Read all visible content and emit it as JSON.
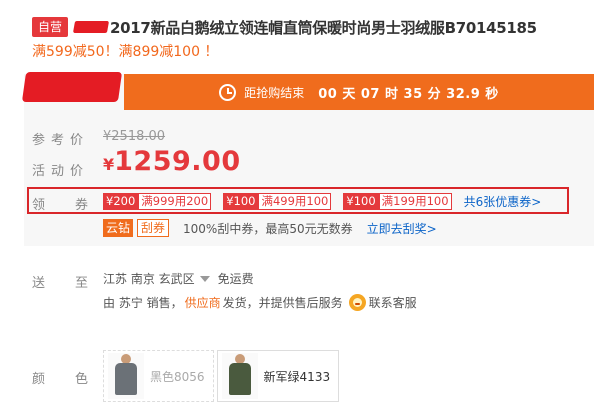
{
  "header": {
    "self_badge": "自营",
    "title": "2017新品白鹅绒立领连帽直筒保暖时尚男士羽绒服B70145185",
    "promo": "满599减50！满899减100 ！"
  },
  "flash_sale": {
    "label": "距抢购结束",
    "countdown": "00 天 07 时 35 分 32.9 秒"
  },
  "pricing": {
    "ref_label": "参考价",
    "ref_price": "¥2518.00",
    "sale_label": "活动价",
    "currency": "¥",
    "sale_price": "1259.00"
  },
  "coupons": {
    "label": "领券",
    "items": [
      {
        "amount": "¥200",
        "condition": "满999用200"
      },
      {
        "amount": "¥100",
        "condition": "满499用100"
      },
      {
        "amount": "¥100",
        "condition": "满199用100"
      }
    ],
    "more": "共6张优惠券>"
  },
  "services": {
    "tag1": "云钻",
    "tag2": "刮券",
    "text": "100%刮中券，最高50元无数券",
    "link": "立即去刮奖>"
  },
  "shipping": {
    "label": "送至",
    "location": "江苏 南京 玄武区",
    "fee": "免运费",
    "seller_prefix": "由 苏宁 销售，",
    "supplier": "供应商",
    "seller_suffix": "发货，并提供售后服务",
    "customer_service": "联系客服"
  },
  "colors": {
    "label": "颜色",
    "options": [
      {
        "name": "黑色8056",
        "available": false
      },
      {
        "name": "新军绿4133",
        "available": true
      }
    ]
  },
  "theme": {
    "accent": "#e4393c",
    "orange": "#f06c1d",
    "link": "#0c64c8"
  }
}
